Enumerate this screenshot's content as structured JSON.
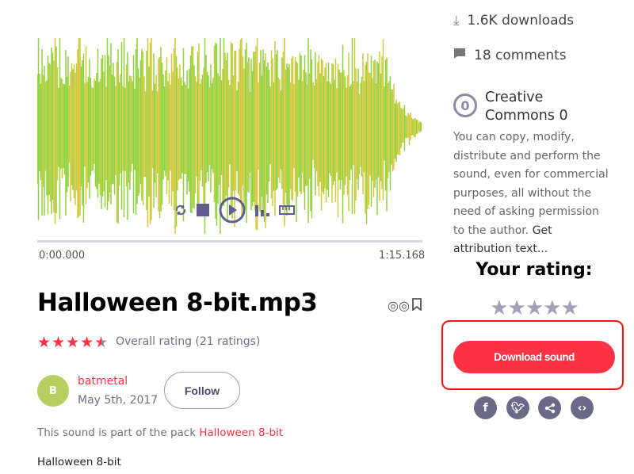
{
  "player": {
    "time_start": "0:00.000",
    "time_end": "1:15.168",
    "progress": 0
  },
  "sound": {
    "title": "Halloween 8-bit.mp3",
    "rating_value": 4.5,
    "rating_max": 5,
    "rating_text": "Overall rating (21 ratings)",
    "author": "batmetal",
    "author_initial": "B",
    "date": "May 5th, 2017",
    "follow_label": "Follow",
    "pack_prefix": "This sound is part of the pack ",
    "pack_name": "Halloween 8-bit",
    "description": "Halloween 8-bit"
  },
  "sidebar": {
    "downloads": "1.6K downloads",
    "comments": "18 comments",
    "license_icon": "0",
    "license_title_1": "Creative",
    "license_title_2": "Commons 0",
    "license_text": "You can copy, modify, distribute and perform the sound, even for commercial purposes, all without the need of asking permission to the author. ",
    "attribution_link": "Get attribution text...",
    "your_rating": "Your rating:",
    "user_rating": 0,
    "download_label": "Download sound"
  },
  "colors": {
    "accent": "#ff3246",
    "icon": "#6a6a88",
    "wave_green": "#8fd23c",
    "wave_yellow": "#d2c83c"
  }
}
